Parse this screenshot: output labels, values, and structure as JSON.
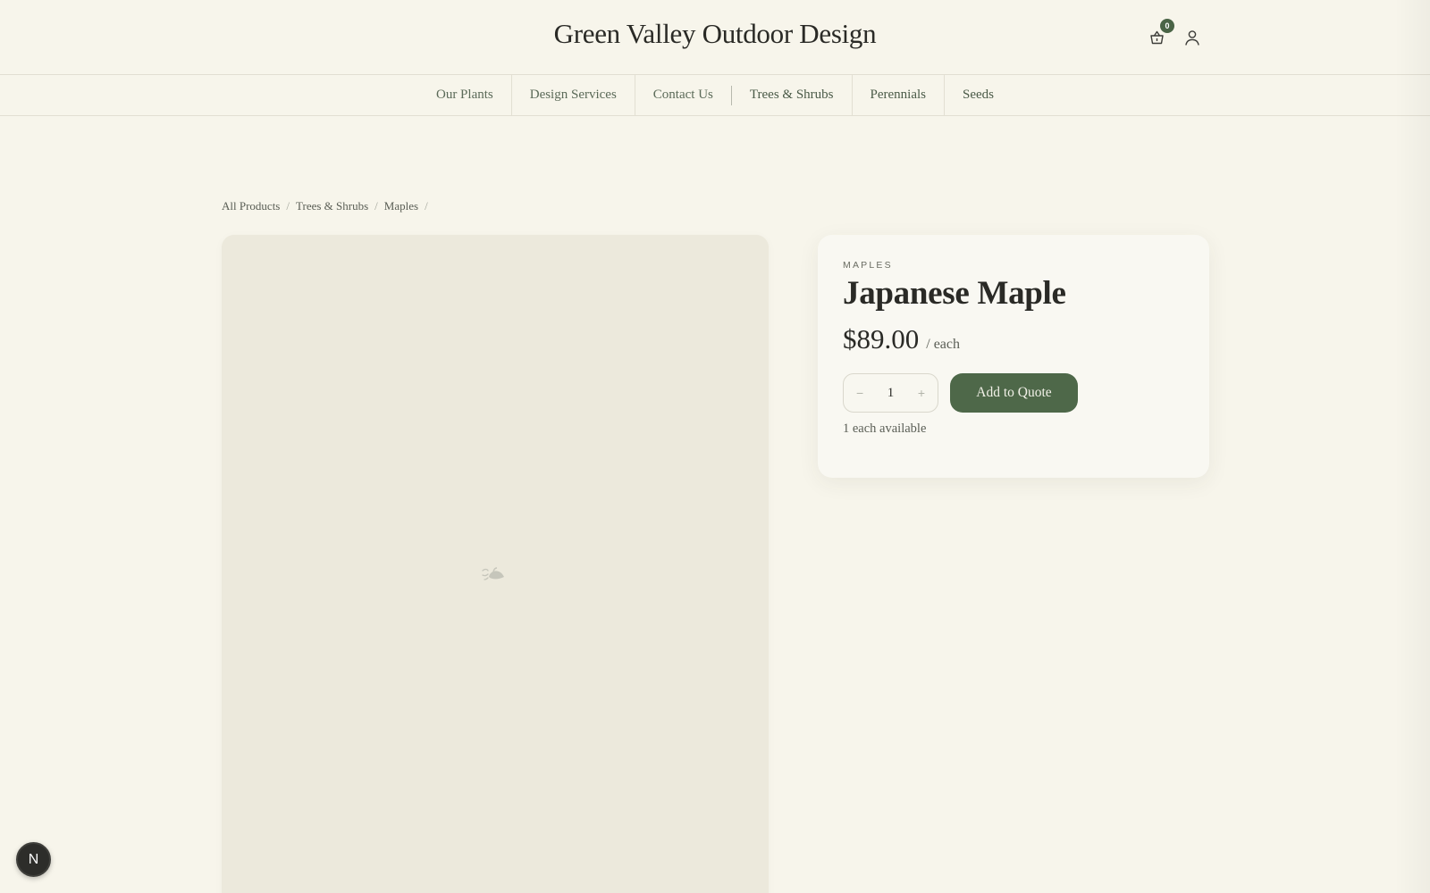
{
  "header": {
    "site_title": "Green Valley Outdoor Design",
    "cart_count": "0",
    "icons": {
      "cart": "basket-icon",
      "account": "user-icon"
    }
  },
  "nav": {
    "pages": [
      "Our Plants",
      "Design Services",
      "Contact Us"
    ],
    "categories": [
      "Trees & Shrubs",
      "Perennials",
      "Seeds"
    ]
  },
  "breadcrumb": {
    "items": [
      "All Products",
      "Trees & Shrubs",
      "Maples"
    ],
    "separator": "/"
  },
  "product": {
    "category": "MAPLES",
    "title": "Japanese Maple",
    "price": "$89.00",
    "unit": "/ each",
    "quantity": "1",
    "decrement": "−",
    "increment": "+",
    "add_button": "Add to Quote",
    "availability": "1 each available",
    "image_placeholder_icon": "plant-placeholder-icon"
  },
  "dev_badge": {
    "label": "N"
  },
  "colors": {
    "background": "#f7f5eb",
    "accent": "#4e6849",
    "image_placeholder": "#ece9dc"
  }
}
